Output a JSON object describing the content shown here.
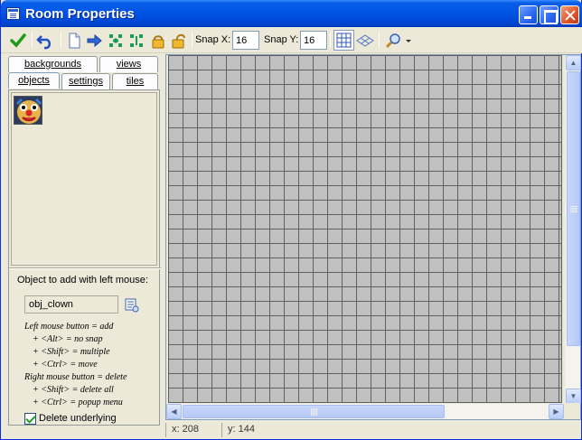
{
  "window": {
    "title": "Room Properties"
  },
  "toolbar": {
    "snap_x_label": "Snap X:",
    "snap_x_value": "16",
    "snap_y_label": "Snap Y:",
    "snap_y_value": "16",
    "icons": [
      "ok-checkmark-icon",
      "undo-icon",
      "clear-icon",
      "shift-right-icon",
      "sort-horizontal-icon",
      "sort-vertical-icon",
      "lock-icon",
      "unlock-icon",
      "grid-icon",
      "isometric-icon",
      "zoom-icon"
    ]
  },
  "tabs": {
    "row_top": [
      {
        "label": "backgrounds"
      },
      {
        "label": "views"
      }
    ],
    "row_bottom": [
      {
        "label": "objects"
      },
      {
        "label": "settings"
      },
      {
        "label": "tiles"
      }
    ],
    "active": "objects"
  },
  "objects_panel": {
    "selected_object_label": "Object to add with left mouse:",
    "selected_object": "obj_clown",
    "help_lines": [
      "Left mouse button = add",
      "+ <Alt> = no snap",
      "+ <Shift> = multiple",
      "+ <Ctrl> = move",
      "Right mouse button = delete",
      "+ <Shift> = delete all",
      "+ <Ctrl> = popup menu"
    ],
    "delete_underlying_label": "Delete underlying",
    "delete_underlying_checked": true
  },
  "status": {
    "x": "x: 208",
    "y": "y: 144"
  },
  "colors": {
    "title_bar": "#0055e5",
    "room_bg": "#c0c0c0",
    "grid": "#606060"
  }
}
